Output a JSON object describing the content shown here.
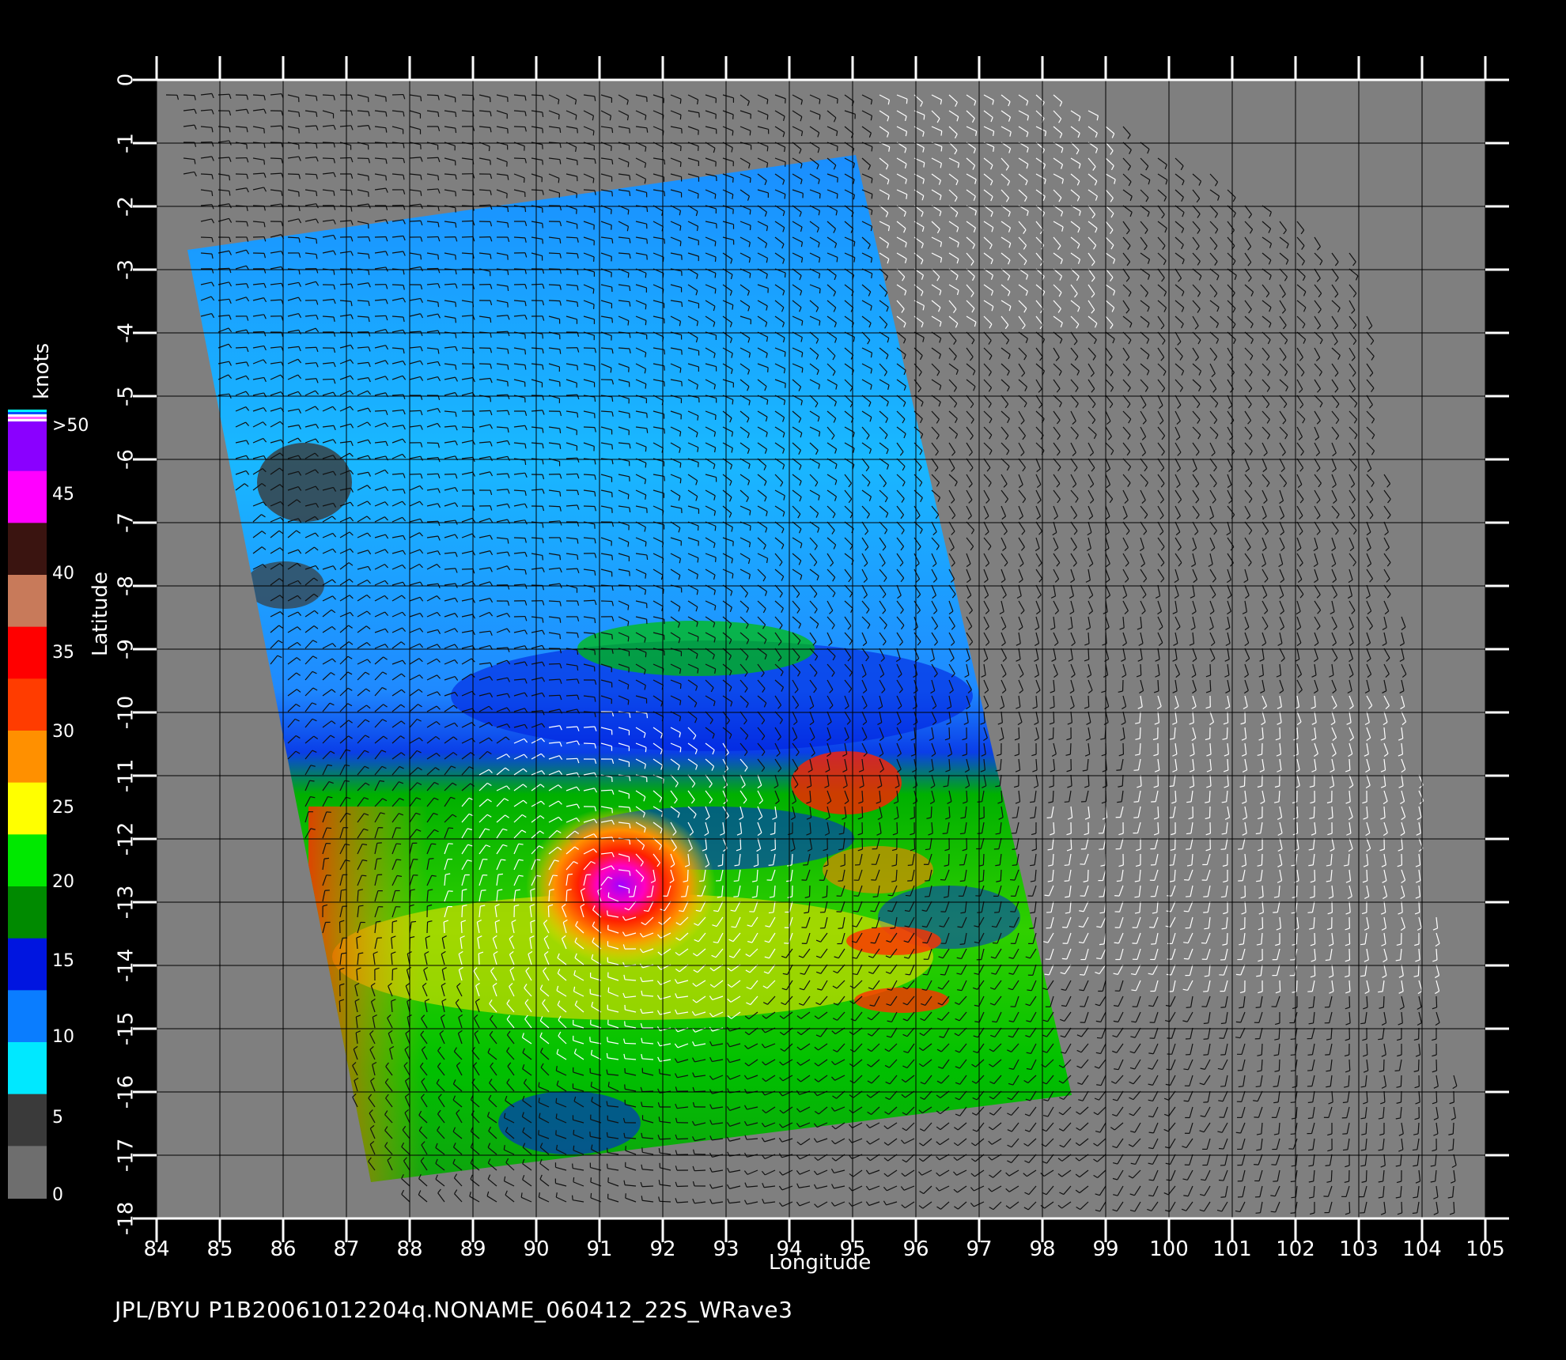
{
  "caption": "JPL/BYU  P1B20061012204q.NONAME_060412_22S_WRave3",
  "axes": {
    "xlabel": "Longitude",
    "ylabel": "Latitude",
    "lon_range": [
      84,
      105
    ],
    "lat_range": [
      -18,
      0
    ],
    "lon_ticks": [
      "84",
      "85",
      "86",
      "87",
      "88",
      "89",
      "90",
      "91",
      "92",
      "93",
      "94",
      "95",
      "96",
      "97",
      "98",
      "99",
      "100",
      "101",
      "102",
      "103",
      "104",
      "105"
    ],
    "lat_ticks": [
      "0",
      "-1",
      "-2",
      "-3",
      "-4",
      "-5",
      "-6",
      "-7",
      "-8",
      "-9",
      "-10",
      "-11",
      "-12",
      "-13",
      "-14",
      "-15",
      "-16",
      "-17",
      "-18"
    ]
  },
  "colorbar": {
    "unit": "knots",
    "labels": [
      "0",
      "5",
      "10",
      "15",
      "20",
      "25",
      "30",
      "35",
      "40",
      "45",
      ">50"
    ],
    "colors": [
      "#6e6e6e",
      "#3a3a3a",
      "#00e8ff",
      "#0a7dff",
      "#0015e0",
      "#008a00",
      "#00e800",
      "#ffff00",
      "#ff9000",
      "#ff3c00",
      "#ff0000",
      "#c87a5a",
      "#3a1410",
      "#ff00ff",
      "#8a00ff"
    ]
  },
  "colors": {
    "background": "#000000",
    "plot_background": "#7f7f7f",
    "grid": "#000000",
    "swath_low": "#1e8cff",
    "swath_high": "#ff2000",
    "barbs_dark": "#111111",
    "barbs_light": "#ffffff"
  },
  "storm_center": {
    "lon": 91.3,
    "lat": -12.8
  }
}
